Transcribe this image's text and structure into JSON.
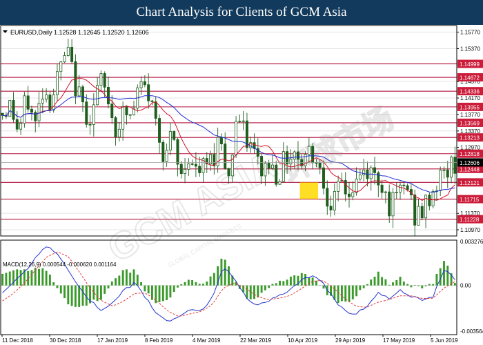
{
  "header": {
    "title": "Chart Analysis for Clients of GCM Asia"
  },
  "watermark": {
    "brand": "GCM ASIA",
    "cn": "环球市场",
    "sub": "GLOBAL CAPITAL MARKETS"
  },
  "colors": {
    "header_bg": "#123a5c",
    "support_line": "#b3123b",
    "ma_fast": "#d2142c",
    "ma_slow": "#1e2bd6",
    "candle": "#1f5e1f",
    "histogram": "#3a9a2a",
    "macd_line": "#2233cc",
    "signal_line": "#e23a3a",
    "label_bg": "#cc1c3a",
    "price_label_bg": "#000000",
    "highlight": "#ffd800"
  },
  "chart_data": [
    {
      "type": "candlestick",
      "symbol_info": "EURUSD,Daily  1.12528 1.12645 1.12520 1.12606",
      "y_ticks": [
        "1.15770",
        "1.15370",
        "1.14570",
        "1.14170",
        "1.13770",
        "1.13370",
        "1.12970",
        "1.11370",
        "1.10970"
      ],
      "ylim": [
        1.1082,
        1.1593
      ],
      "current_price": "1.12606",
      "levels": [
        {
          "label": "1.14999",
          "value": 1.14999
        },
        {
          "label": "1.14672",
          "value": 1.14672
        },
        {
          "label": "1.14336",
          "value": 1.14336
        },
        {
          "label": "1.13955",
          "value": 1.13955
        },
        {
          "label": "1.13569",
          "value": 1.13569
        },
        {
          "label": "1.13213",
          "value": 1.13213
        },
        {
          "label": "1.12818",
          "value": 1.12818
        },
        {
          "label": "1.12448",
          "value": 1.12448
        },
        {
          "label": "1.12121",
          "value": 1.12121
        },
        {
          "label": "1.11715",
          "value": 1.11715
        },
        {
          "label": "1.11228",
          "value": 1.11228
        }
      ],
      "x_ticks": [
        "11 Dec 2018",
        "30 Dec 2018",
        "17 Jan 2019",
        "8 Feb 2019",
        "4 Mar 2019",
        "22 Mar 2019",
        "10 Apr 2019",
        "29 Apr 2019",
        "17 May 2019",
        "5 Jun 2019"
      ],
      "anchor_values": [
        1.138,
        1.14,
        1.133,
        1.142,
        1.135,
        1.144,
        1.141,
        1.148,
        1.153,
        1.145,
        1.139,
        1.137,
        1.146,
        1.142,
        1.134,
        1.138,
        1.137,
        1.145,
        1.143,
        1.136,
        1.128,
        1.132,
        1.122,
        1.128,
        1.123,
        1.125,
        1.127,
        1.133,
        1.122,
        1.138,
        1.132,
        1.129,
        1.124,
        1.126,
        1.123,
        1.127,
        1.129,
        1.127,
        1.129,
        1.127,
        1.119,
        1.116,
        1.121,
        1.118,
        1.122,
        1.124,
        1.123,
        1.121,
        1.115,
        1.118,
        1.121,
        1.113,
        1.114,
        1.118,
        1.122,
        1.124,
        1.126
      ],
      "series": [
        {
          "name": "EURUSD",
          "kind": "candles"
        },
        {
          "kind": "fast-ma"
        },
        {
          "kind": "slow-ma"
        }
      ]
    },
    {
      "type": "macd",
      "label": "MACD(12,26,9) 0.000544 -0.000620 0.001164",
      "y_ticks": [
        "0.003276",
        "0.00",
        "-0.003564"
      ],
      "ylim": [
        -0.0038,
        0.0035
      ],
      "macd_anchor_values": [
        -0.0005,
        0.0002,
        0.001,
        0.0022,
        0.003,
        0.0024,
        0.0012,
        -0.0002,
        -0.0012,
        -0.002,
        -0.0014,
        -0.0004,
        0.0002,
        -0.001,
        -0.0022,
        -0.0028,
        -0.0024,
        -0.0018,
        -0.002,
        -0.001,
        0.0015,
        0.0005,
        -0.0008,
        -0.0016,
        -0.0012,
        -0.0008,
        -0.0004,
        0.0003,
        0.0008,
        0.0002,
        -0.001,
        -0.002,
        -0.0022,
        -0.0016,
        -0.0006,
        -0.001,
        -0.0004,
        -0.0008,
        -0.0012,
        -0.0009,
        0.0012,
        0.0005
      ],
      "signal_anchor_values": [
        -0.0012,
        -0.0006,
        0.0002,
        0.0012,
        0.0022,
        0.0026,
        0.0022,
        0.001,
        -0.0003,
        -0.0012,
        -0.0016,
        -0.0012,
        -0.0006,
        -0.0006,
        -0.0012,
        -0.002,
        -0.0024,
        -0.0022,
        -0.002,
        -0.0015,
        -0.0002,
        0.0002,
        -0.0002,
        -0.0008,
        -0.0011,
        -0.001,
        -0.0008,
        -0.0003,
        0.0003,
        0.0004,
        -0.0002,
        -0.001,
        -0.0016,
        -0.0017,
        -0.0013,
        -0.0011,
        -0.0008,
        -0.0008,
        -0.001,
        -0.001,
        -0.0002,
        0.0003
      ]
    }
  ]
}
